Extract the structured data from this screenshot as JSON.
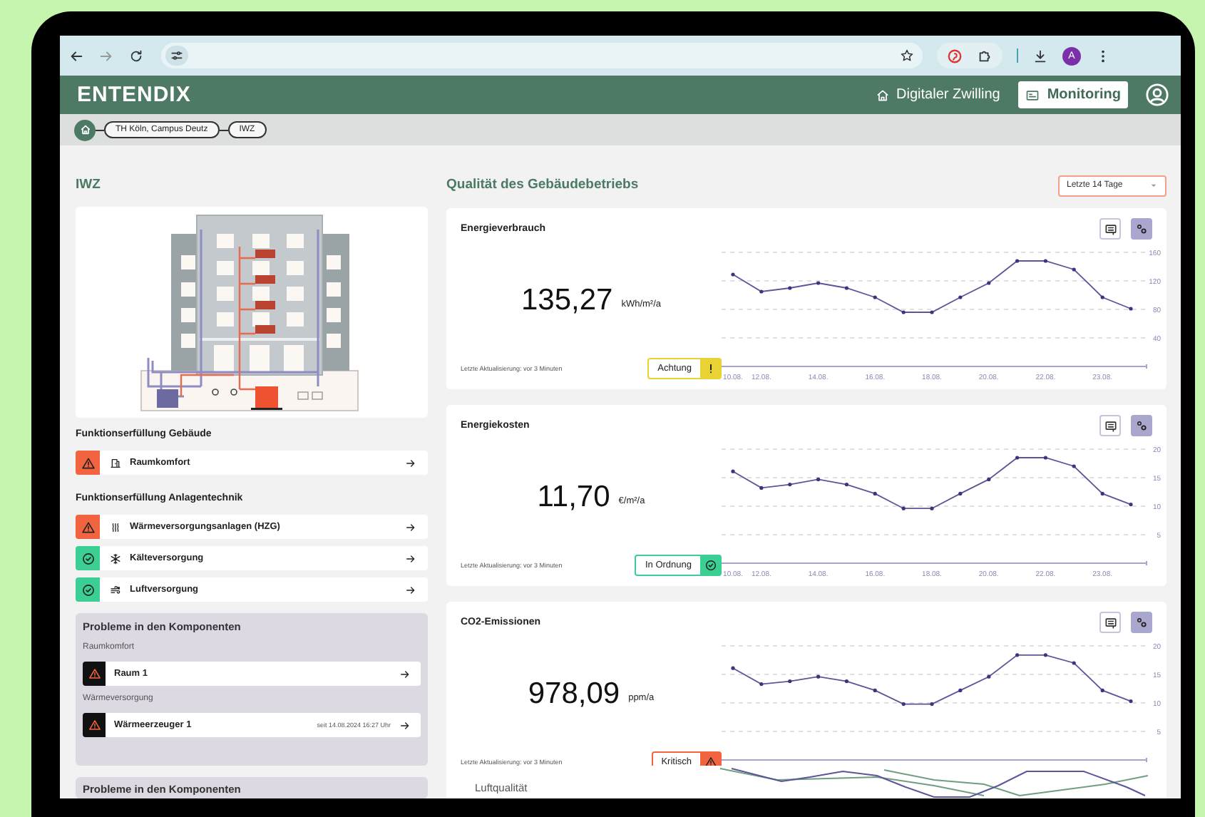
{
  "browser": {
    "avatar": "A"
  },
  "app_header": {
    "logo": "ENTENDIX",
    "nav": [
      {
        "label": "Digitaler Zwilling",
        "kind": "twin",
        "selected": false
      },
      {
        "label": "Monitoring",
        "kind": "monitor",
        "selected": true
      }
    ]
  },
  "breadcrumb": [
    "TH Köln, Campus Deutz",
    "IWZ"
  ],
  "building": {
    "title": "IWZ"
  },
  "sections": [
    {
      "title": "Funktionserfüllung Gebäude",
      "items": [
        {
          "label": "Raumkomfort",
          "kind": "room",
          "ok": false
        }
      ]
    },
    {
      "title": "Funktionserfüllung Anlagentechnik",
      "items": [
        {
          "label": "Wärmeversorgungsanlagen (HZG)",
          "kind": "heating",
          "ok": false
        },
        {
          "label": "Kälteversorgung",
          "kind": "cooling",
          "ok": true
        },
        {
          "label": "Luftversorgung",
          "kind": "air",
          "ok": true
        }
      ]
    }
  ],
  "problems": {
    "title": "Probleme in den Komponenten",
    "groups": [
      {
        "title": "Raumkomfort",
        "items": [
          {
            "label": "Raum 1"
          }
        ]
      },
      {
        "title": "Wärmeversorgung",
        "items": [
          {
            "label": "Wärmeerzeuger 1",
            "since": "seit 14.08.2024 16:27 Uhr"
          }
        ]
      }
    ]
  },
  "quality": {
    "title": "Qualität des Gebäudebetriebs",
    "period": "Letzte 14 Tage",
    "cards": [
      {
        "title": "Energieverbrauch",
        "value": "135,27",
        "unit": "kWh/m²/a",
        "updated": "Letzte Aktualisierung: vor 3 Minuten",
        "kind": "warning",
        "status_label": "Achtung",
        "chart_data": {
          "type": "line",
          "categories": [
            "10.08.",
            "12.08.",
            null,
            "14.08.",
            null,
            "16.08.",
            null,
            "18.08.",
            null,
            "20.08.",
            null,
            "22.08.",
            null,
            "23.08.",
            null
          ],
          "ylim": [
            0,
            160
          ],
          "yticks": [
            40,
            80,
            120,
            160
          ],
          "grid": true,
          "series": [
            {
              "color": "#5b559a",
              "values": [
                129,
                105,
                110,
                117,
                110,
                97,
                76,
                76,
                97,
                117,
                148,
                148,
                136,
                97,
                81
              ]
            }
          ]
        }
      },
      {
        "title": "Energiekosten",
        "value": "11,70",
        "unit": "€/m²/a",
        "updated": "Letzte Aktualisierung: vor 3 Minuten",
        "kind": "ok",
        "status_label": "In Ordnung",
        "chart_data": {
          "type": "line",
          "categories": [
            "10.08.",
            "12.08.",
            null,
            "14.08.",
            null,
            "16.08.",
            null,
            "18.08.",
            null,
            "20.08.",
            null,
            "22.08.",
            null,
            "23.08.",
            null
          ],
          "ylim": [
            0,
            20
          ],
          "yticks": [
            5,
            10,
            15,
            20
          ],
          "grid": true,
          "series": [
            {
              "color": "#5b559a",
              "values": [
                16.1,
                13.2,
                13.8,
                14.7,
                13.8,
                12.2,
                9.6,
                9.6,
                12.2,
                14.7,
                18.5,
                18.5,
                17,
                12.2,
                10.3
              ]
            }
          ]
        }
      },
      {
        "title": "CO2-Emissionen",
        "value": "978,09",
        "unit": "ppm/a",
        "updated": "Letzte Aktualisierung: vor 3 Minuten",
        "kind": "critical",
        "status_label": "Kritisch",
        "chart_data": {
          "type": "line",
          "categories": [
            null,
            null,
            null,
            null,
            null,
            null,
            null,
            null,
            null,
            null,
            null,
            null,
            null,
            null,
            null
          ],
          "ylim": [
            0,
            20
          ],
          "yticks": [
            5,
            10,
            15,
            20
          ],
          "grid": true,
          "series": [
            {
              "color": "#5b559a",
              "values": [
                16.1,
                13.3,
                13.8,
                14.6,
                13.8,
                12.2,
                9.8,
                9.8,
                12.2,
                14.6,
                18.4,
                18.4,
                17,
                12.2,
                10.3
              ]
            }
          ]
        }
      }
    ]
  },
  "overlay": {
    "problems_title": "Probleme in den Komponenten",
    "card_title": "Luftqualität"
  }
}
